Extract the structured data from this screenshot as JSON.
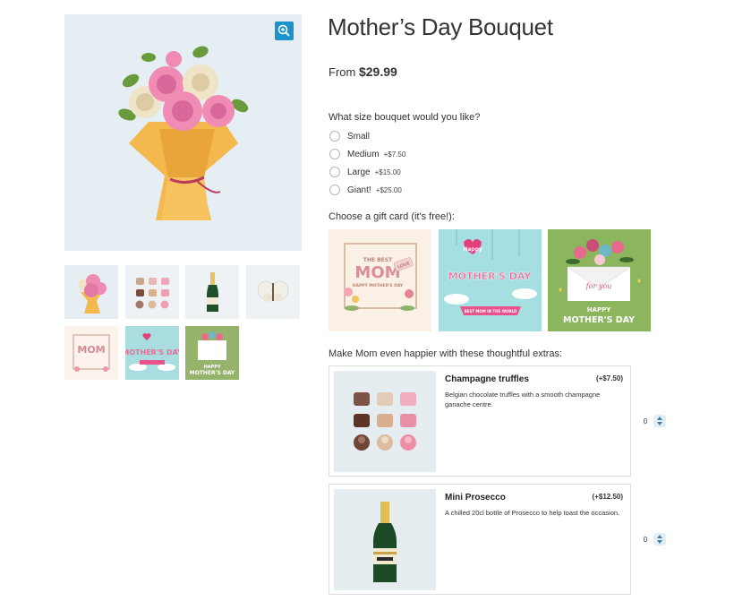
{
  "product": {
    "title": "Mother’s Day Bouquet",
    "price_prefix": "From",
    "price": "$29.99"
  },
  "size_question": "What size bouquet would you like?",
  "size_options": [
    {
      "label": "Small",
      "addon": ""
    },
    {
      "label": "Medium",
      "addon": "+$7.50"
    },
    {
      "label": "Large",
      "addon": "+$15.00"
    },
    {
      "label": "Giant!",
      "addon": "+$25.00"
    }
  ],
  "card_question": "Choose a gift card (it's free!):",
  "cards": [
    {
      "line1": "THE BEST",
      "line2": "MOM",
      "tag": "LOVE",
      "sub": "HAPPY MOTHER'S DAY"
    },
    {
      "line1": "Happy",
      "line2": "MOTHER'S DAY",
      "sub": "BEST MOM IN THE WORLD"
    },
    {
      "line1": "for you",
      "line2": "HAPPY",
      "line3": "MOTHER'S DAY"
    }
  ],
  "extras_question": "Make Mom even happier with these thoughtful extras:",
  "extras": [
    {
      "name": "Champagne truffles",
      "price": "(+$7.50)",
      "description": "Belgian chocolate truffles with a smooth champagne ganache centre.",
      "qty": "0"
    },
    {
      "name": "Mini Prosecco",
      "price": "(+$12.50)",
      "description": "A chilled 20cl bottle of Prosecco to help toast the occasion.",
      "qty": "0"
    }
  ],
  "colors": {
    "accent": "#1d93c9",
    "image_bg": "#e5eef3",
    "border": "#dedede"
  }
}
